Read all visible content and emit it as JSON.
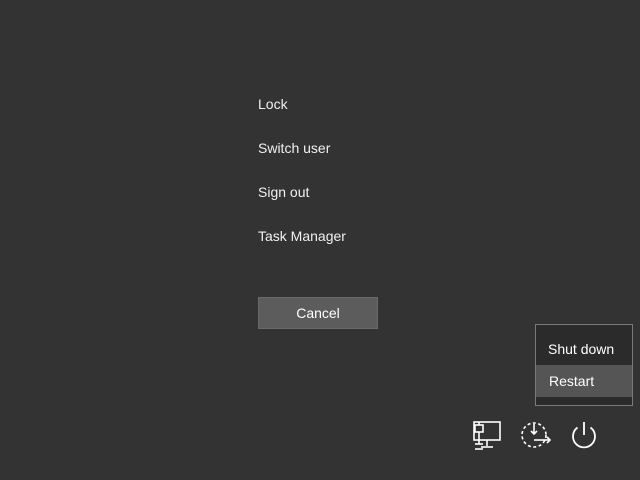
{
  "options_menu": {
    "items": [
      {
        "label": "Lock"
      },
      {
        "label": "Switch user"
      },
      {
        "label": "Sign out"
      },
      {
        "label": "Task Manager"
      }
    ]
  },
  "cancel_label": "Cancel",
  "power_menu": {
    "items": [
      {
        "label": "Shut down",
        "highlighted": false
      },
      {
        "label": "Restart",
        "highlighted": true
      }
    ]
  },
  "tray": {
    "icons": [
      "network-icon",
      "ease-of-access-icon",
      "power-icon"
    ]
  },
  "colors": {
    "background": "#333333",
    "button": "#5c5c5c",
    "menu_background": "#2b2b2b",
    "menu_highlight": "#555555",
    "text": "#ffffff"
  }
}
